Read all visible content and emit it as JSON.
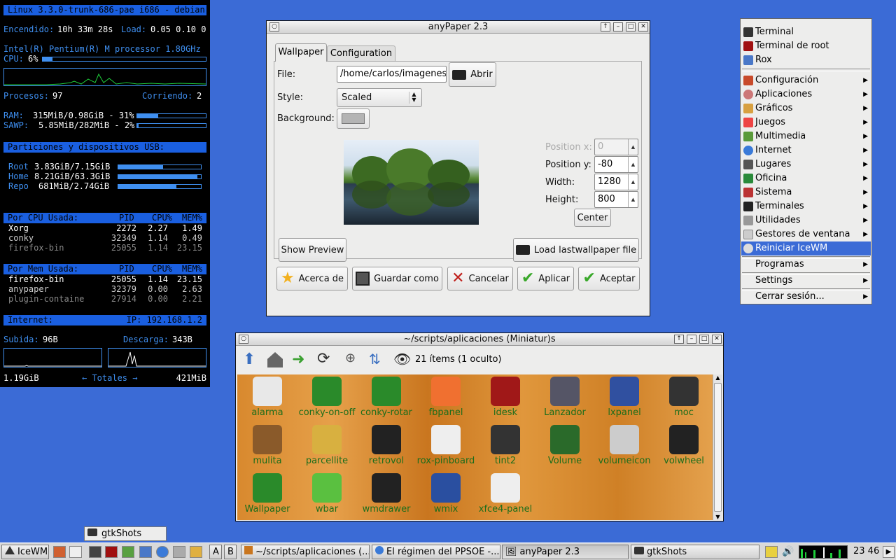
{
  "conky": {
    "header": "Linux 3.3.0-trunk-686-pae i686 - debian",
    "uptime_label": "Encendido:",
    "uptime_value": "10h 33m 28s",
    "load_label": "Load:",
    "load_value": "0.05 0.10 0",
    "cpu_model": "Intel(R) Pentium(R) M processor 1.80GHz",
    "cpu_label": "CPU:",
    "cpu_value": "6%",
    "cpu_pct": 6,
    "procs_label": "Procesos:",
    "procs_value": "97",
    "running_label": "Corriendo:",
    "running_value": "2",
    "ram_label": "RAM:",
    "ram_value": "315MiB/0.98GiB - 31%",
    "ram_pct": 31,
    "swap_label": "SAWP:",
    "swap_value": "5.85MiB/282MiB - 2%",
    "swap_pct": 2,
    "partitions_header": "Particiones y dispositivos USB:",
    "partitions": [
      {
        "name": "Root",
        "usage": "3.83GiB/7.15GiB",
        "pct": 54
      },
      {
        "name": "Home",
        "usage": "8.21GiB/63.3GiB",
        "pct": 96
      },
      {
        "name": "Repo",
        "usage": "681MiB/2.74GiB",
        "pct": 70
      }
    ],
    "cpu_table_header": "Por CPU Usada:",
    "mem_table_header": "Por Mem Usada:",
    "col_pid": "PID",
    "col_cpu": "CPU%",
    "col_mem": "MEM%",
    "cpu_rows": [
      {
        "name": "Xorg",
        "pid": "2272",
        "cpu": "2.27",
        "mem": "1.49"
      },
      {
        "name": "conky",
        "pid": "32349",
        "cpu": "1.14",
        "mem": "0.49"
      },
      {
        "name": "firefox-bin",
        "pid": "25055",
        "cpu": "1.14",
        "mem": "23.15"
      }
    ],
    "mem_rows": [
      {
        "name": "firefox-bin",
        "pid": "25055",
        "cpu": "1.14",
        "mem": "23.15"
      },
      {
        "name": "anypaper",
        "pid": "32379",
        "cpu": "0.00",
        "mem": "2.63"
      },
      {
        "name": "plugin-containe",
        "pid": "27914",
        "cpu": "0.00",
        "mem": "2.21"
      }
    ],
    "internet_label": "Internet:",
    "ip_label": "IP: 192.168.1.2",
    "upload_label": "Subida:",
    "upload_value": "96B",
    "download_label": "Descarga:",
    "download_value": "343B",
    "total_up": "1.19GiB",
    "totals_label": "← Totales →",
    "total_down": "421MiB"
  },
  "anypaper": {
    "title": "anyPaper 2.3",
    "tabs": [
      "Wallpaper",
      "Configuration"
    ],
    "file_label": "File:",
    "file_value": "/home/carlos/imagenes/",
    "open_button": "Abrir",
    "style_label": "Style:",
    "style_value": "Scaled",
    "background_label": "Background:",
    "posx_label": "Position x:",
    "posx_value": "0",
    "posy_label": "Position y:",
    "posy_value": "-80",
    "width_label": "Width:",
    "width_value": "1280",
    "height_label": "Height:",
    "height_value": "800",
    "center_button": "Center",
    "show_preview_button": "Show Preview",
    "load_last_button": "Load lastwallpaper file",
    "about_button": "Acerca de",
    "save_as_button": "Guardar como",
    "cancel_button": "Cancelar",
    "apply_button": "Aplicar",
    "accept_button": "Aceptar"
  },
  "menu": {
    "top_items": [
      "Terminal",
      "Terminal de root",
      "Rox"
    ],
    "categories": [
      "Configuración",
      "Aplicaciones",
      "Gráficos",
      "Juegos",
      "Multimedia",
      "Internet",
      "Lugares",
      "Oficina",
      "Sistema",
      "Terminales",
      "Utilidades",
      "Gestores de ventana"
    ],
    "restart": "Reiniciar IceWM",
    "bottom_items": [
      "Programas",
      "Settings",
      "Cerrar sesión..."
    ]
  },
  "rox": {
    "title": "~/scripts/aplicaciones (Miniatur)s",
    "status": "21 ítems (1 oculto)",
    "items": [
      "alarma",
      "conky-on-off",
      "conky-rotar",
      "fbpanel",
      "idesk",
      "Lanzador",
      "lxpanel",
      "moc",
      "mulita",
      "parcellite",
      "retrovol",
      "rox-pinboard",
      "tint2",
      "Volume",
      "volumeicon",
      "volwheel",
      "Wallpaper",
      "wbar",
      "wmdrawer",
      "wmix",
      "xfce4-panel"
    ]
  },
  "minimized": {
    "gtkshots": "gtkShots"
  },
  "taskbar": {
    "start": "IceWM",
    "ws1": "A",
    "ws2": "B",
    "tasks": [
      "~/scripts/aplicaciones (...",
      "El régimen del PPSOE -...",
      "anyPaper 2.3",
      "gtkShots"
    ],
    "clock": "23 46"
  }
}
